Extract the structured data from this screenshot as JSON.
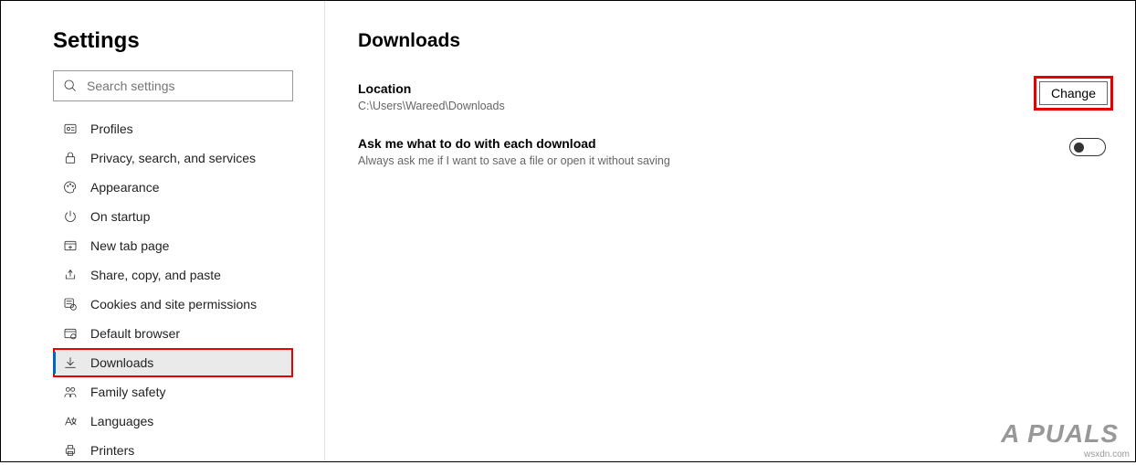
{
  "sidebar": {
    "title": "Settings",
    "search_placeholder": "Search settings",
    "items": [
      {
        "label": "Profiles"
      },
      {
        "label": "Privacy, search, and services"
      },
      {
        "label": "Appearance"
      },
      {
        "label": "On startup"
      },
      {
        "label": "New tab page"
      },
      {
        "label": "Share, copy, and paste"
      },
      {
        "label": "Cookies and site permissions"
      },
      {
        "label": "Default browser"
      },
      {
        "label": "Downloads"
      },
      {
        "label": "Family safety"
      },
      {
        "label": "Languages"
      },
      {
        "label": "Printers"
      }
    ]
  },
  "main": {
    "title": "Downloads",
    "location": {
      "label": "Location",
      "value": "C:\\Users\\Wareed\\Downloads",
      "button": "Change"
    },
    "ask": {
      "label": "Ask me what to do with each download",
      "desc": "Always ask me if I want to save a file or open it without saving",
      "toggle_on": false
    }
  },
  "watermark": "wsxdn.com",
  "logo_text": "A  PUALS"
}
